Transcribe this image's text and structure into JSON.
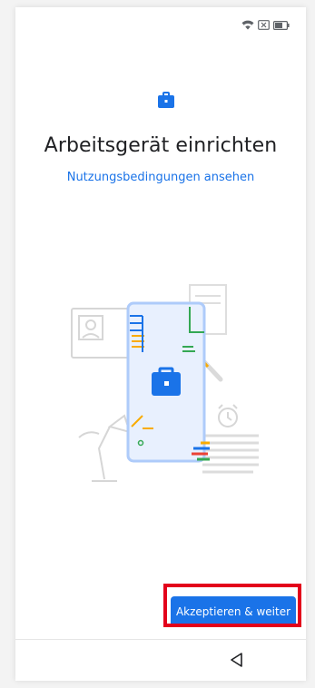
{
  "header": {
    "title": "Arbeitsgerät einrichten",
    "terms_link": "Nutzungsbedingungen ansehen"
  },
  "footer": {
    "accept_button": "Akzeptieren & weiter"
  },
  "status_bar": {
    "icons": [
      "wifi-icon",
      "no-sim-icon",
      "battery-icon"
    ]
  },
  "icons": {
    "header_icon": "briefcase-icon",
    "nav_back": "back-triangle-icon"
  },
  "colors": {
    "accent": "#1a73e8",
    "highlight": "#e3001b"
  }
}
